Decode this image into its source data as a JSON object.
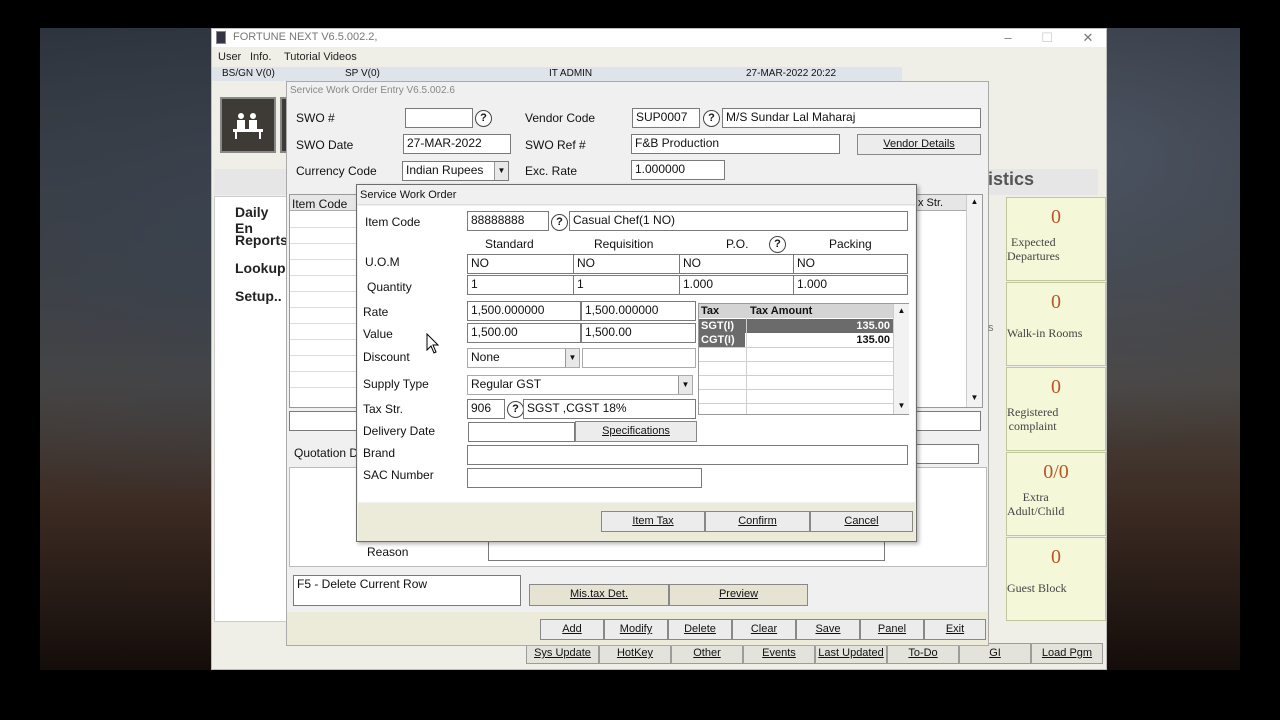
{
  "main_window": {
    "title": "FORTUNE NEXT  V6.5.002.2,",
    "menu": [
      "User",
      "Info.",
      "Tutorial Videos"
    ],
    "status": {
      "bs_gn": "BS/GN V(0)",
      "sp": "SP V(0)",
      "user": "IT ADMIN",
      "datetime": "27-MAR-2022 20:22"
    },
    "left_menu": [
      "Daily En",
      "Reports",
      "Lookup",
      "Setup.."
    ],
    "statistics_title": "tistics",
    "stats": [
      {
        "value": "0",
        "label": "Expected\nDepartures"
      },
      {
        "value": "0",
        "label": "Walk-in Rooms"
      },
      {
        "value": "0",
        "label": "Registered\ncomplaint"
      },
      {
        "value": "0/0",
        "label": "Extra\nAdult/Child"
      },
      {
        "value": "0",
        "label": "Guest Block"
      }
    ],
    "toolbar": [
      "Sys Update",
      "HotKey",
      "Other",
      "Events",
      "Last Updated",
      "To-Do",
      "GI",
      "Load Pgm"
    ]
  },
  "swo": {
    "title": "Service Work Order Entry  V6.5.002.6",
    "swo_no_label": "SWO #",
    "swo_no_value": "",
    "swo_date_label": "SWO Date",
    "swo_date_value": "27-MAR-2022",
    "currency_label": "Currency Code",
    "currency_value": "Indian Rupees",
    "vendor_code_label": "Vendor Code",
    "vendor_code_value": "SUP0007",
    "vendor_name": "M/S Sundar Lal Maharaj",
    "swo_ref_label": "SWO Ref #",
    "swo_ref_value": "F&B Production",
    "exc_rate_label": "Exc. Rate",
    "exc_rate_value": "1.000000",
    "vendor_details_btn": "Vendor Details",
    "grid_headers": [
      "Item Code",
      "x Str."
    ],
    "quotation_label": "Quotation D",
    "reason_label": "Reason",
    "delete_hint": "F5 - Delete Current Row",
    "mis_tax_btn": "Mis.tax Det.",
    "preview_btn": "Preview",
    "actions": [
      "Add",
      "Modify",
      "Delete",
      "Clear",
      "Save",
      "Panel",
      "Exit"
    ],
    "actions_right_marker": "s"
  },
  "dialog": {
    "title": "Service Work Order",
    "item_code_label": "Item Code",
    "item_code_value": "88888888",
    "item_desc": "Casual Chef(1 NO)",
    "columns": [
      "Standard",
      "Requisition",
      "P.O.",
      "Packing"
    ],
    "uom_label": "U.O.M",
    "uom": [
      "NO",
      "NO",
      "NO",
      "NO"
    ],
    "qty_label": "Quantity",
    "qty": [
      "1",
      "1",
      "1.000",
      "1.000"
    ],
    "rate_label": "Rate",
    "rate": [
      "1,500.000000",
      "1,500.000000"
    ],
    "value_label": "Value",
    "value": [
      "1,500.00",
      "1,500.00"
    ],
    "discount_label": "Discount",
    "discount_value": "None",
    "supply_type_label": "Supply Type",
    "supply_type_value": "Regular GST",
    "tax_str_label": "Tax Str.",
    "tax_str_code": "906",
    "tax_str_desc": "SGST ,CGST 18%",
    "delivery_label": "Delivery Date",
    "delivery_value": "",
    "specifications_btn": "Specifications",
    "brand_label": "Brand",
    "brand_value": "",
    "sac_label": "SAC Number",
    "sac_value": "",
    "tax_grid": {
      "headers": [
        "Tax",
        "Tax Amount"
      ],
      "rows": [
        {
          "tax": "SGT(I)",
          "amount": "135.00"
        },
        {
          "tax": "CGT(I)",
          "amount": "135.00"
        }
      ]
    },
    "buttons": [
      "Item Tax",
      "Confirm",
      "Cancel"
    ]
  }
}
